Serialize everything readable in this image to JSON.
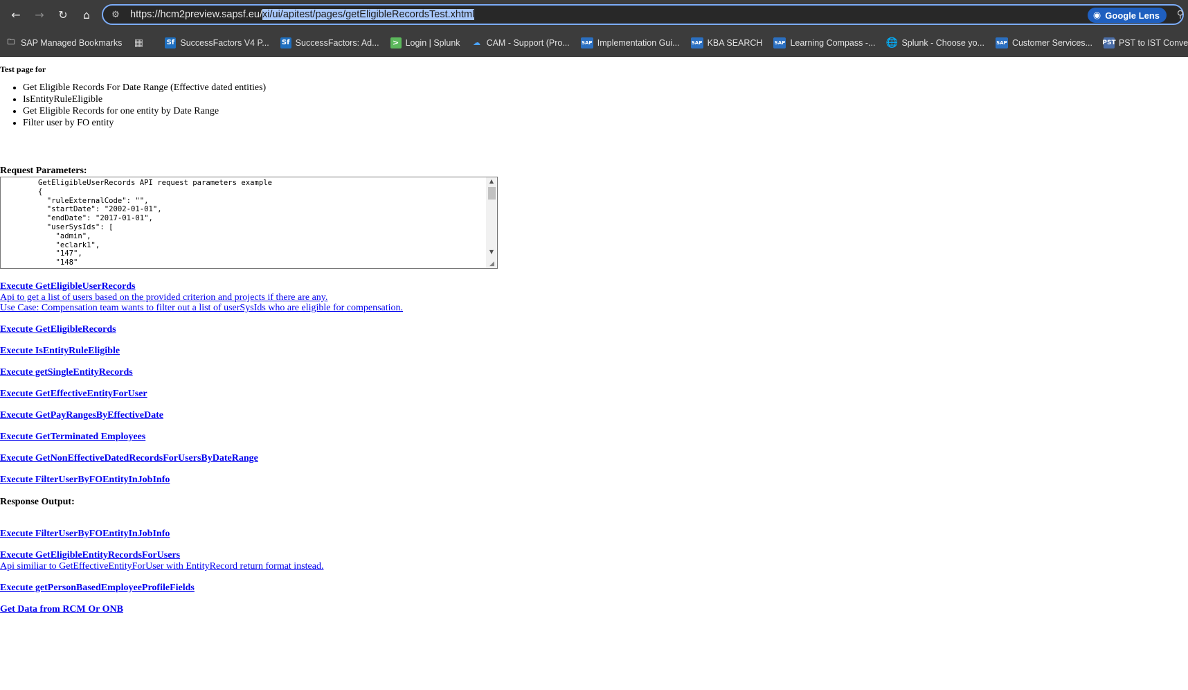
{
  "browser": {
    "url_host": "https://hcm2preview.sapsf.eu/",
    "url_path": "xi/ui/apitest/pages/getEligibleRecordsTest.xhtml",
    "lens_label": "Google Lens",
    "bookmarks": [
      {
        "label": "SAP Managed Bookmarks",
        "icon": "folder-icon"
      },
      {
        "label": "SuccessFactors V4 P...",
        "icon": "successfactors-icon"
      },
      {
        "label": "SuccessFactors: Ad...",
        "icon": "successfactors-icon"
      },
      {
        "label": "Login | Splunk",
        "icon": "splunk-icon"
      },
      {
        "label": "CAM - Support (Pro...",
        "icon": "cloud-icon"
      },
      {
        "label": "Implementation Gui...",
        "icon": "sap-icon"
      },
      {
        "label": "KBA SEARCH",
        "icon": "sap-icon"
      },
      {
        "label": "Learning Compass -...",
        "icon": "sap-icon"
      },
      {
        "label": "Splunk - Choose yo...",
        "icon": "globe-icon"
      },
      {
        "label": "Customer Services...",
        "icon": "sap-icon"
      },
      {
        "label": "PST to IST Converte...",
        "icon": "pst-icon"
      }
    ]
  },
  "page": {
    "title": "Test page for",
    "features": [
      "Get Eligible Records For Date Range (Effective dated entities)",
      "IsEntityRuleEligible",
      "Get Eligible Records for one entity by Date Range",
      "Filter user by FO entity"
    ],
    "params_label": "Request Parameters:",
    "params_text": "        GetEligibleUserRecords API request parameters example\n        {\n          \"ruleExternalCode\": \"\",\n          \"startDate\": \"2002-01-01\",\n          \"endDate\": \"2017-01-01\",\n          \"userSysIds\": [\n            \"admin\",\n            \"eclark1\",\n            \"147\",\n            \"148\"\n          ],",
    "links": {
      "get_eligible_user_records": "Execute GetEligibleUserRecords",
      "get_eligible_user_records_desc1": "Api to get a list of users based on the provided criterion and projects if there are any.",
      "get_eligible_user_records_desc2": "Use Case: Compensation team wants to filter out a list of userSysIds who are eligible for compensation.",
      "get_eligible_records": "Execute GetEligibleRecords",
      "is_entity_rule_eligible": "Execute IsEntityRuleEligible",
      "get_single_entity_records": "Execute getSingleEntityRecords",
      "get_effective_entity_for_user": "Execute GetEffectiveEntityForUser",
      "get_pay_ranges": "Execute GetPayRangesByEffectiveDate",
      "get_terminated_employees": "Execute GetTerminated Employees",
      "get_non_effective_dated": "Execute GetNonEffectiveDatedRecordsForUsersByDateRange",
      "filter_user_by_fo_entity": "Execute FilterUserByFOEntityInJobInfo ",
      "filter_user_by_fo_entity_2": "Execute FilterUserByFOEntityInJobInfo",
      "get_eligible_entity_records": "Execute GetEligibleEntityRecordsForUsers",
      "get_eligible_entity_records_desc": "Api similiar to GetEffectiveEntityForUser with EntityRecord return format instead.",
      "get_person_based": "Execute getPersonBasedEmployeeProfileFields",
      "get_data_rcm_onb": "Get Data from RCM Or ONB"
    },
    "response_label": "Response Output:"
  }
}
